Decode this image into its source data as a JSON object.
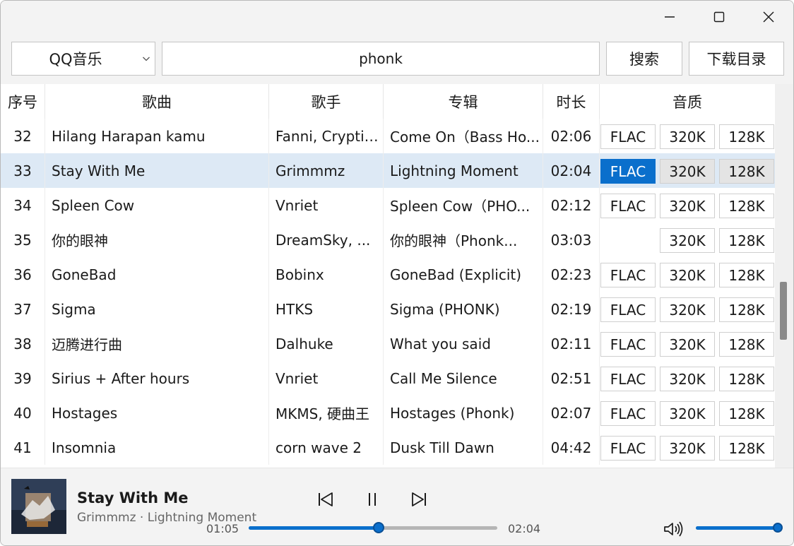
{
  "toolbar": {
    "source": "QQ音乐",
    "search_value": "phonk",
    "search_button": "搜索",
    "download_dir_button": "下载目录"
  },
  "columns": {
    "num": "序号",
    "song": "歌曲",
    "artist": "歌手",
    "album": "专辑",
    "duration": "时长",
    "quality": "音质"
  },
  "rows": [
    {
      "num": "32",
      "song": "Hilang Harapan kamu",
      "artist": "Fanni, Cryptix...",
      "album": "Come On（Bass Ho...",
      "duration": "02:06",
      "flac": "FLAC",
      "q320": "320K",
      "q128": "128K"
    },
    {
      "num": "33",
      "song": "Stay With Me",
      "artist": "Grimmmz",
      "album": "Lightning Moment",
      "duration": "02:04",
      "flac": "FLAC",
      "q320": "320K",
      "q128": "128K"
    },
    {
      "num": "34",
      "song": "Spleen Cow",
      "artist": "Vnriet",
      "album": "Spleen Cow（PHO...",
      "duration": "02:12",
      "flac": "FLAC",
      "q320": "320K",
      "q128": "128K"
    },
    {
      "num": "35",
      "song": "你的眼神",
      "artist": "DreamSky, ...",
      "album": "你的眼神（Phonk...",
      "duration": "03:03",
      "flac": "",
      "q320": "320K",
      "q128": "128K"
    },
    {
      "num": "36",
      "song": "GoneBad",
      "artist": "Bobinx",
      "album": "GoneBad (Explicit)",
      "duration": "02:23",
      "flac": "FLAC",
      "q320": "320K",
      "q128": "128K"
    },
    {
      "num": "37",
      "song": "Sigma",
      "artist": "HTKS",
      "album": "Sigma (PHONK)",
      "duration": "02:19",
      "flac": "FLAC",
      "q320": "320K",
      "q128": "128K"
    },
    {
      "num": "38",
      "song": "迈腾进行曲",
      "artist": "Dalhuke",
      "album": "What you said",
      "duration": "02:11",
      "flac": "FLAC",
      "q320": "320K",
      "q128": "128K"
    },
    {
      "num": "39",
      "song": "Sirius + After hours",
      "artist": "Vnriet",
      "album": "Call Me Silence",
      "duration": "02:51",
      "flac": "FLAC",
      "q320": "320K",
      "q128": "128K"
    },
    {
      "num": "40",
      "song": "Hostages",
      "artist": "MKMS, 硬曲王",
      "album": "Hostages (Phonk)",
      "duration": "02:07",
      "flac": "FLAC",
      "q320": "320K",
      "q128": "128K"
    },
    {
      "num": "41",
      "song": "Insomnia",
      "artist": "corn wave 2",
      "album": "Dusk Till Dawn",
      "duration": "04:42",
      "flac": "FLAC",
      "q320": "320K",
      "q128": "128K"
    }
  ],
  "selected_row": 1,
  "player": {
    "title": "Stay With Me",
    "subtitle": "Grimmmz · Lightning Moment",
    "elapsed": "01:05",
    "total": "02:04",
    "progress_fraction": 0.524,
    "volume_fraction": 1.0
  },
  "colors": {
    "accent": "#0a6fcc",
    "selected_row": "#dde9f5"
  }
}
